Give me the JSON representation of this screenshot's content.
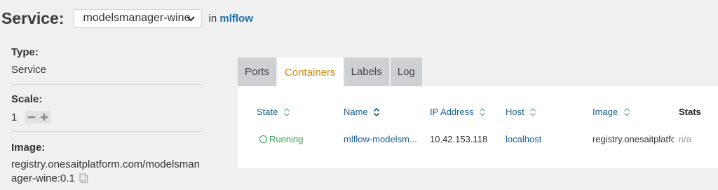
{
  "header": {
    "service_label": "Service:",
    "selected_service": "modelsmanager-wine",
    "in_label": "in",
    "namespace": "mlflow"
  },
  "info": {
    "type_label": "Type:",
    "type_value": "Service",
    "scale_label": "Scale:",
    "scale_value": "1",
    "image_label": "Image:",
    "image_value": "registry.onesaitplatform.com/modelsmanager-wine:0.1"
  },
  "tabs": [
    {
      "label": "Ports",
      "active": false
    },
    {
      "label": "Containers",
      "active": true
    },
    {
      "label": "Labels",
      "active": false
    },
    {
      "label": "Log",
      "active": false
    }
  ],
  "table": {
    "columns": [
      "State",
      "Name",
      "IP Address",
      "Host",
      "Image",
      "Stats"
    ],
    "rows": [
      {
        "state": "Running",
        "name": "mlflow-modelsm...",
        "ip": "10.42.153.118",
        "host": "localhost",
        "image": "registry.onesaitplatfo",
        "stats": "n/a"
      }
    ]
  },
  "colors": {
    "accent": "#d4880f",
    "link": "#1a5f8e",
    "running": "#3a9d54"
  },
  "icons": [
    "chevron-down-icon",
    "minus-icon",
    "plus-icon",
    "copy-icon",
    "sort-icon",
    "state-circle-icon"
  ]
}
